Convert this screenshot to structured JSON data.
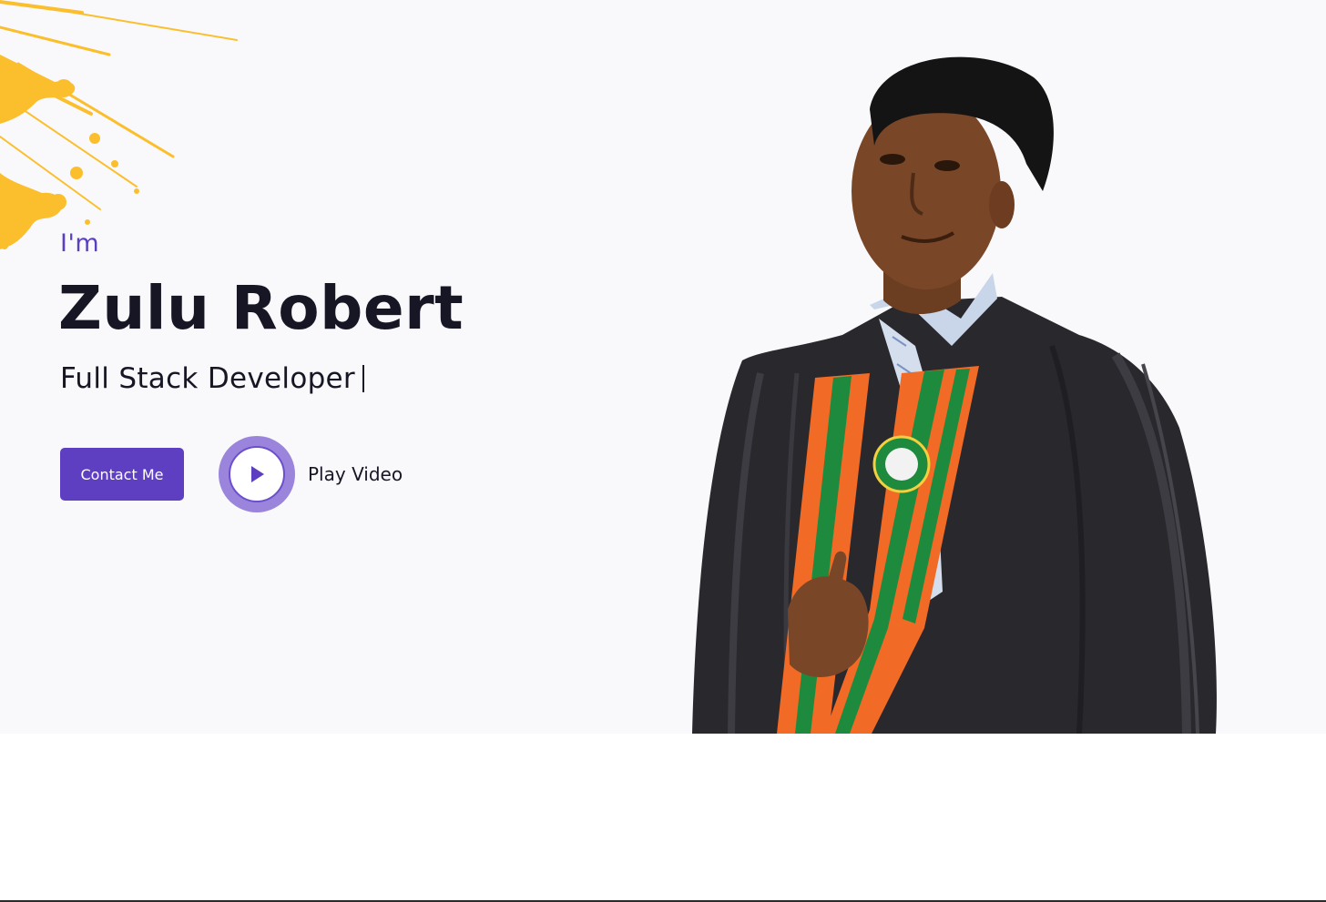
{
  "hero": {
    "intro": "I'm",
    "name": "Zulu Robert",
    "role": "Full Stack Developer",
    "contact_label": "Contact Me",
    "play_label": "Play Video"
  },
  "icons": {
    "play": "play-icon",
    "splash": "paint-splash"
  },
  "colors": {
    "accent": "#5e3fc2",
    "accent_light": "#9b85dc",
    "splash": "#fbbf2e",
    "text": "#161625",
    "hero_bg": "#f9f9fb"
  }
}
